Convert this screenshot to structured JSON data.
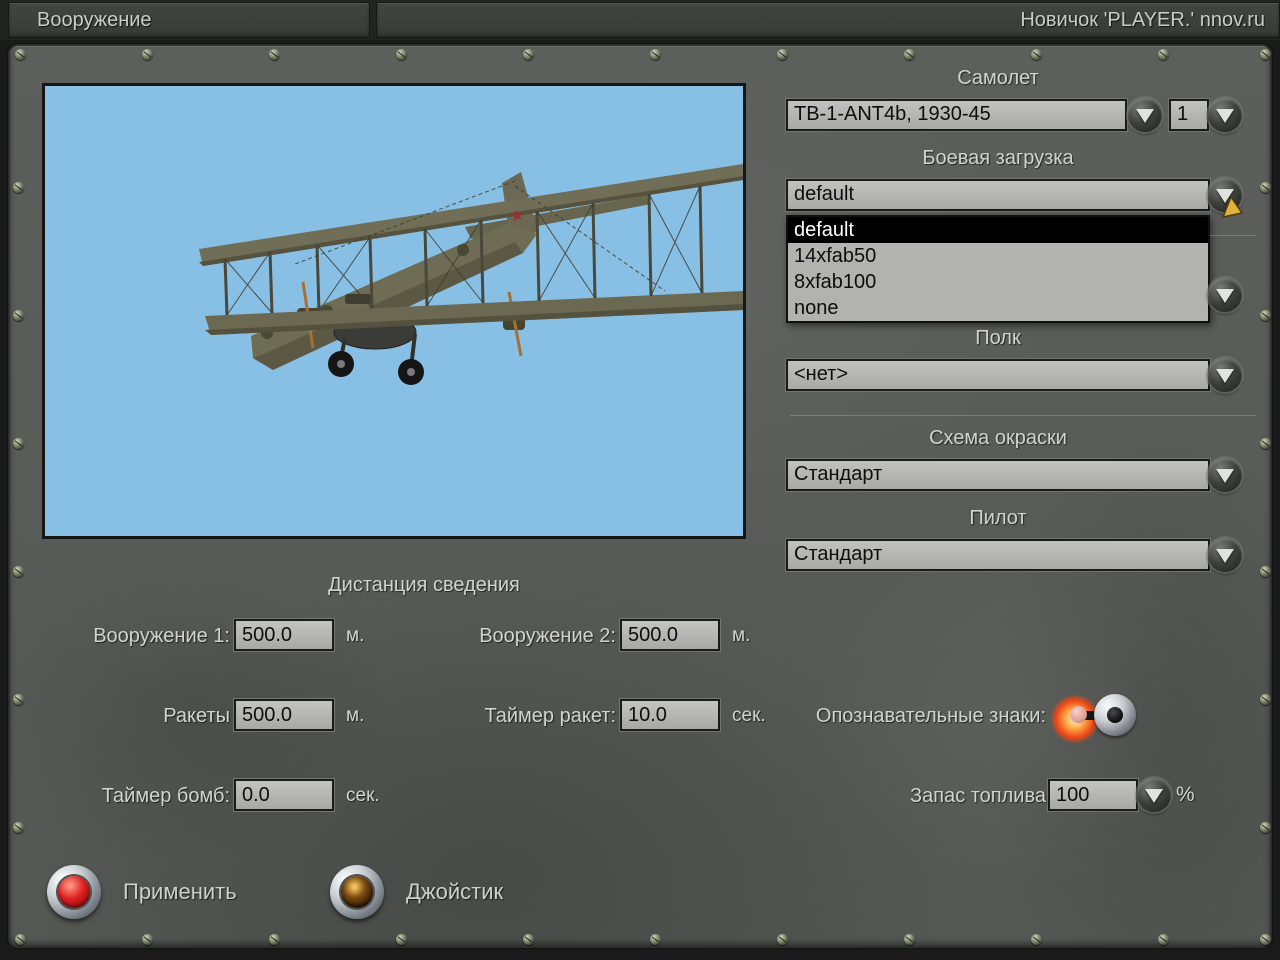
{
  "colors": {
    "sky": "#88bfe4",
    "panel_gray": "#5a5c59",
    "field_bg": "#b4b4b2",
    "selected_item_bg": "#000000",
    "cursor_yellow": "#e0b23c",
    "lamp_glow_orange": "#ee4617",
    "apply_button_red": "#df2020"
  },
  "header": {
    "armament_tab": "Вооружение",
    "player_tab": "Новичок 'PLAYER.' nnov.ru"
  },
  "aircraft": {
    "label": "Самолет",
    "selected": "ТВ-1-ANT4b, 1930-45",
    "count": "1"
  },
  "loadout": {
    "label": "Боевая загрузка",
    "selected": "default",
    "highlighted_option": "default",
    "options": [
      "default",
      "14xfab50",
      "8xfab100",
      "none"
    ]
  },
  "regiment": {
    "label": "Полк",
    "selected": "<нет>"
  },
  "paint_scheme": {
    "label": "Схема окраски",
    "selected": "Стандарт"
  },
  "pilot": {
    "label": "Пилот",
    "selected": "Стандарт"
  },
  "convergence": {
    "title": "Дистанция сведения",
    "weapon1": {
      "label": "Вооружение 1:",
      "value": "500.0",
      "unit": "м."
    },
    "weapon2": {
      "label": "Вооружение 2:",
      "value": "500.0",
      "unit": "м."
    },
    "rockets": {
      "label": "Ракеты",
      "value": "500.0",
      "unit": "м."
    },
    "rocket_timer": {
      "label": "Таймер ракет:",
      "value": "10.0",
      "unit": "сек."
    },
    "bomb_timer": {
      "label": "Таймер бомб:",
      "value": "0.0",
      "unit": "сек."
    }
  },
  "markings": {
    "label": "Опознавательные знаки:",
    "state": "on"
  },
  "fuel": {
    "label": "Запас топлива",
    "value": "100",
    "unit": "%"
  },
  "actions": {
    "apply": "Применить",
    "joystick": "Джойстик"
  }
}
